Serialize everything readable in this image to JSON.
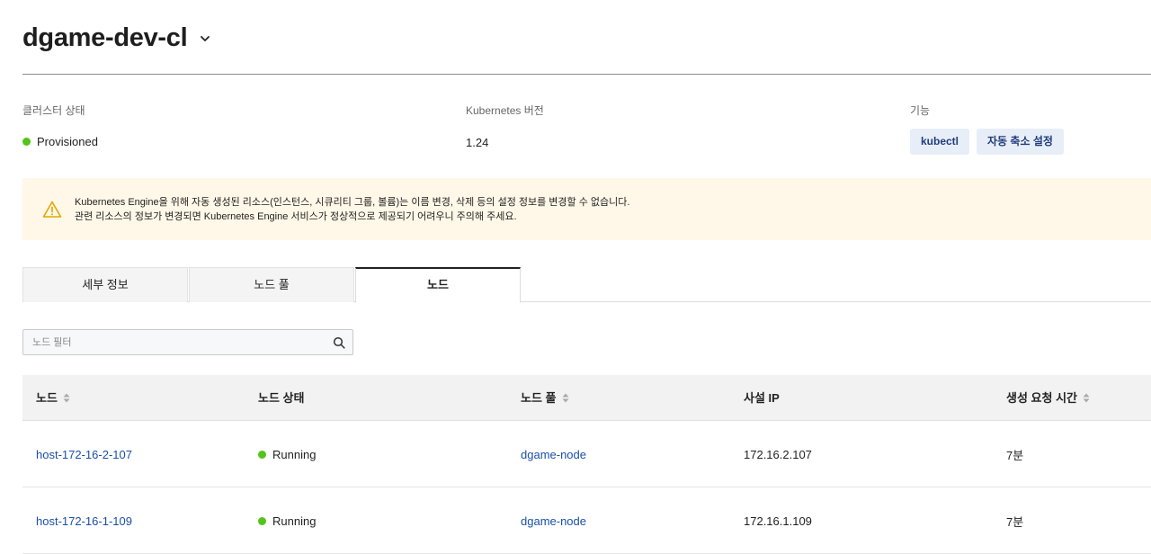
{
  "header": {
    "title": "dgame-dev-cl",
    "dropdown_icon": "chevron-down-icon"
  },
  "cluster_status": {
    "label": "클러스터 상태",
    "value": "Provisioned",
    "color": "#52c41a"
  },
  "k8s_version": {
    "label": "Kubernetes 버전",
    "value": "1.24"
  },
  "features": {
    "label": "기능",
    "items": [
      "kubectl",
      "자동 축소 설정"
    ]
  },
  "warning": {
    "icon": "warning-triangle-icon",
    "line1": "Kubernetes Engine을 위해 자동 생성된 리소스(인스턴스, 시큐리티 그룹, 볼륨)는 이름 변경, 삭제 등의 설정 정보를 변경할 수 없습니다.",
    "line2": "관련 리소스의 정보가 변경되면 Kubernetes Engine 서비스가 정상적으로 제공되기 어려우니 주의해 주세요."
  },
  "tabs": [
    {
      "label": "세부 정보",
      "active": false
    },
    {
      "label": "노드 풀",
      "active": false
    },
    {
      "label": "노드",
      "active": true
    }
  ],
  "search": {
    "placeholder": "노드 필터",
    "value": ""
  },
  "table": {
    "columns": [
      "노드",
      "노드 상태",
      "노드 풀",
      "사설 IP",
      "생성 요청 시간"
    ],
    "rows": [
      {
        "node": "host-172-16-2-107",
        "status": "Running",
        "pool": "dgame-node",
        "ip": "172.16.2.107",
        "created": "7분"
      },
      {
        "node": "host-172-16-1-109",
        "status": "Running",
        "pool": "dgame-node",
        "ip": "172.16.1.109",
        "created": "7분"
      }
    ]
  }
}
